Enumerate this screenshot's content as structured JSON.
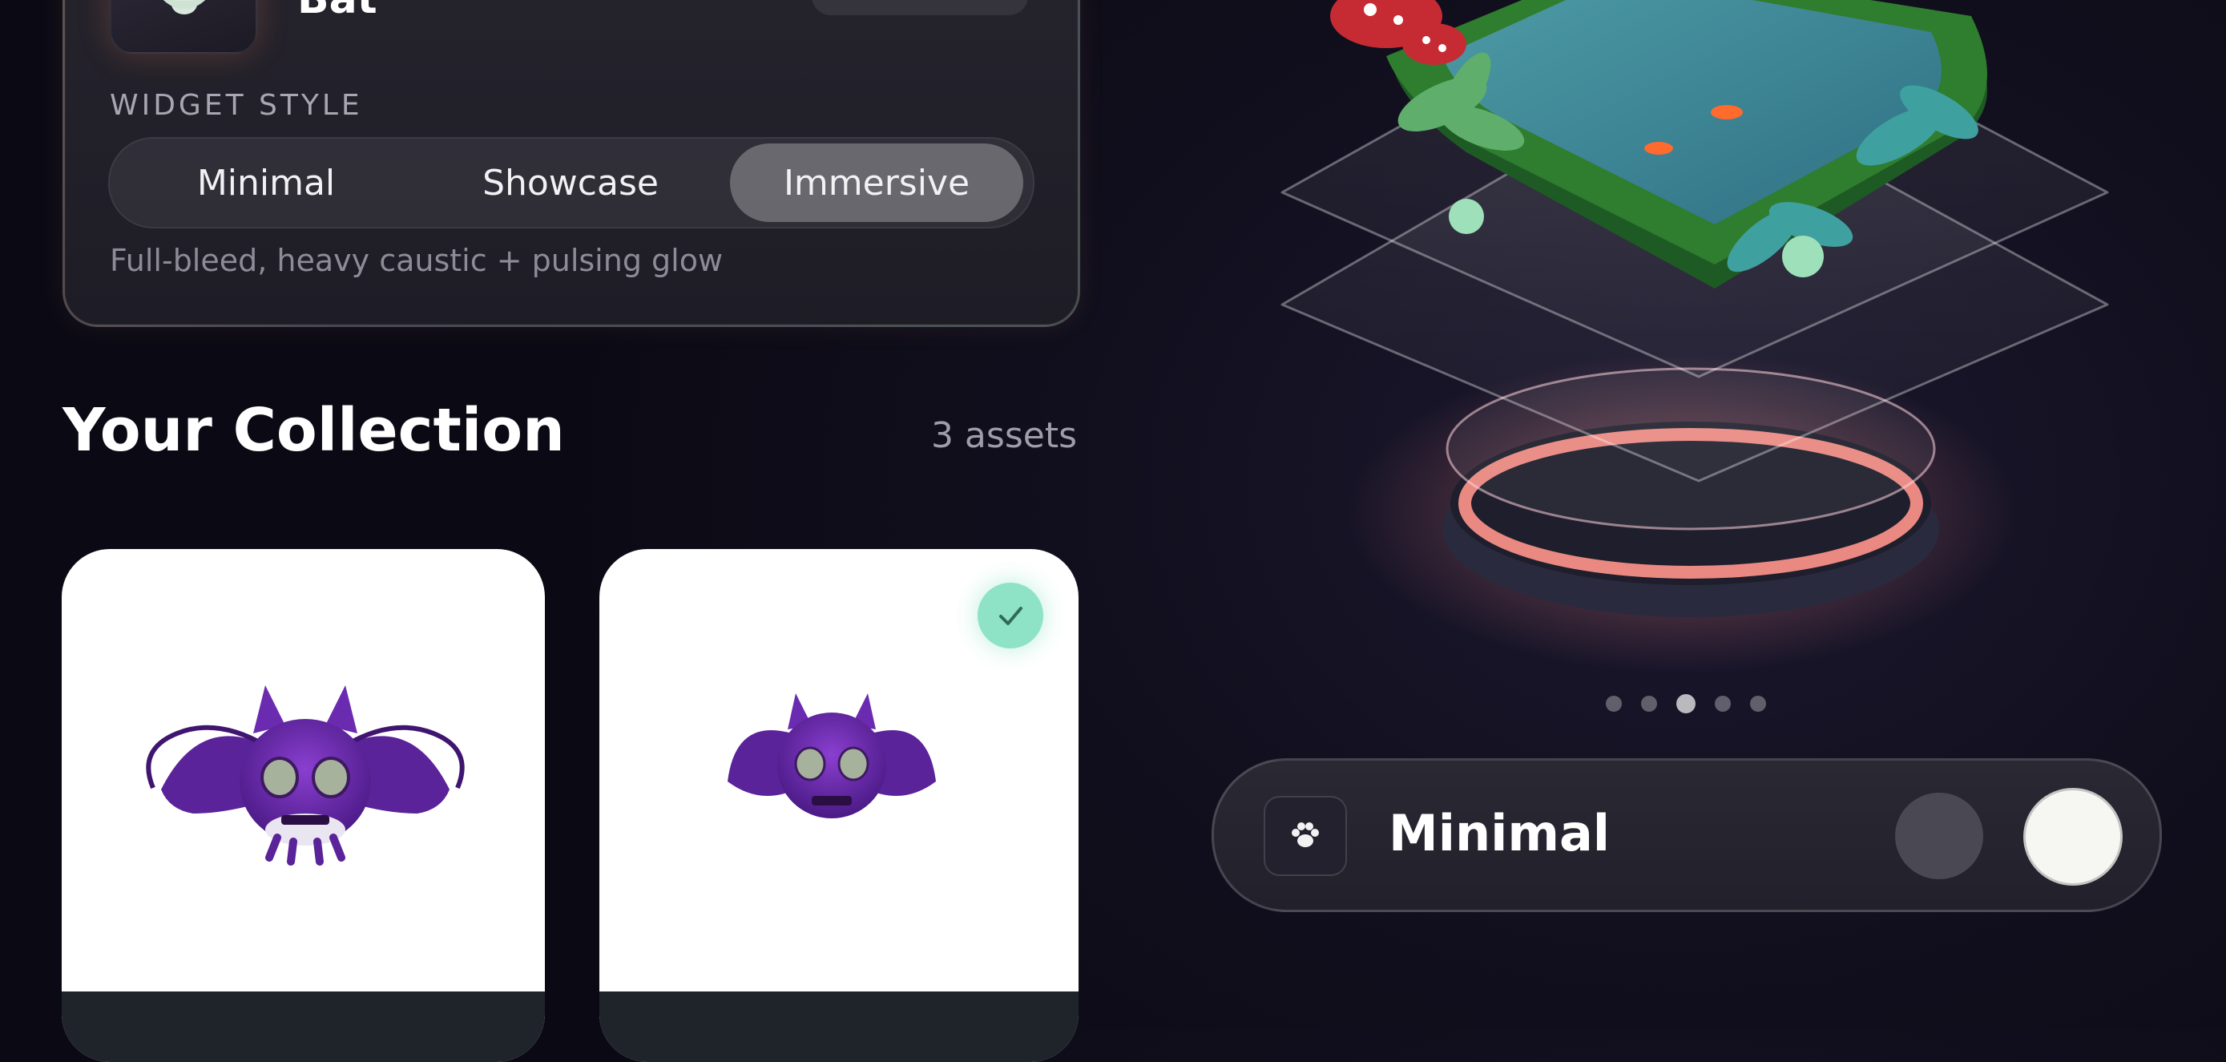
{
  "asset": {
    "name": "Bat"
  },
  "widget_style": {
    "label": "WIDGET STYLE",
    "options": [
      "Minimal",
      "Showcase",
      "Immersive"
    ],
    "selected": "Immersive",
    "description": "Full-bleed, heavy caustic + pulsing glow"
  },
  "collection": {
    "title": "Your Collection",
    "count": "3 assets",
    "items": [
      {
        "icon": "purple-bat-icon",
        "selected": false
      },
      {
        "icon": "purple-bat-icon",
        "selected": true
      }
    ]
  },
  "preview": {
    "pages": 5,
    "active_page": 3,
    "style_bar": {
      "icon": "paw-icon",
      "label": "Minimal",
      "swatches": [
        "#4a4853",
        "#f6f6f2"
      ]
    }
  },
  "colors": {
    "accent_check": "#8ee2c5",
    "glow": "#ff8f86",
    "bat_purple": "#6f2fb0"
  }
}
